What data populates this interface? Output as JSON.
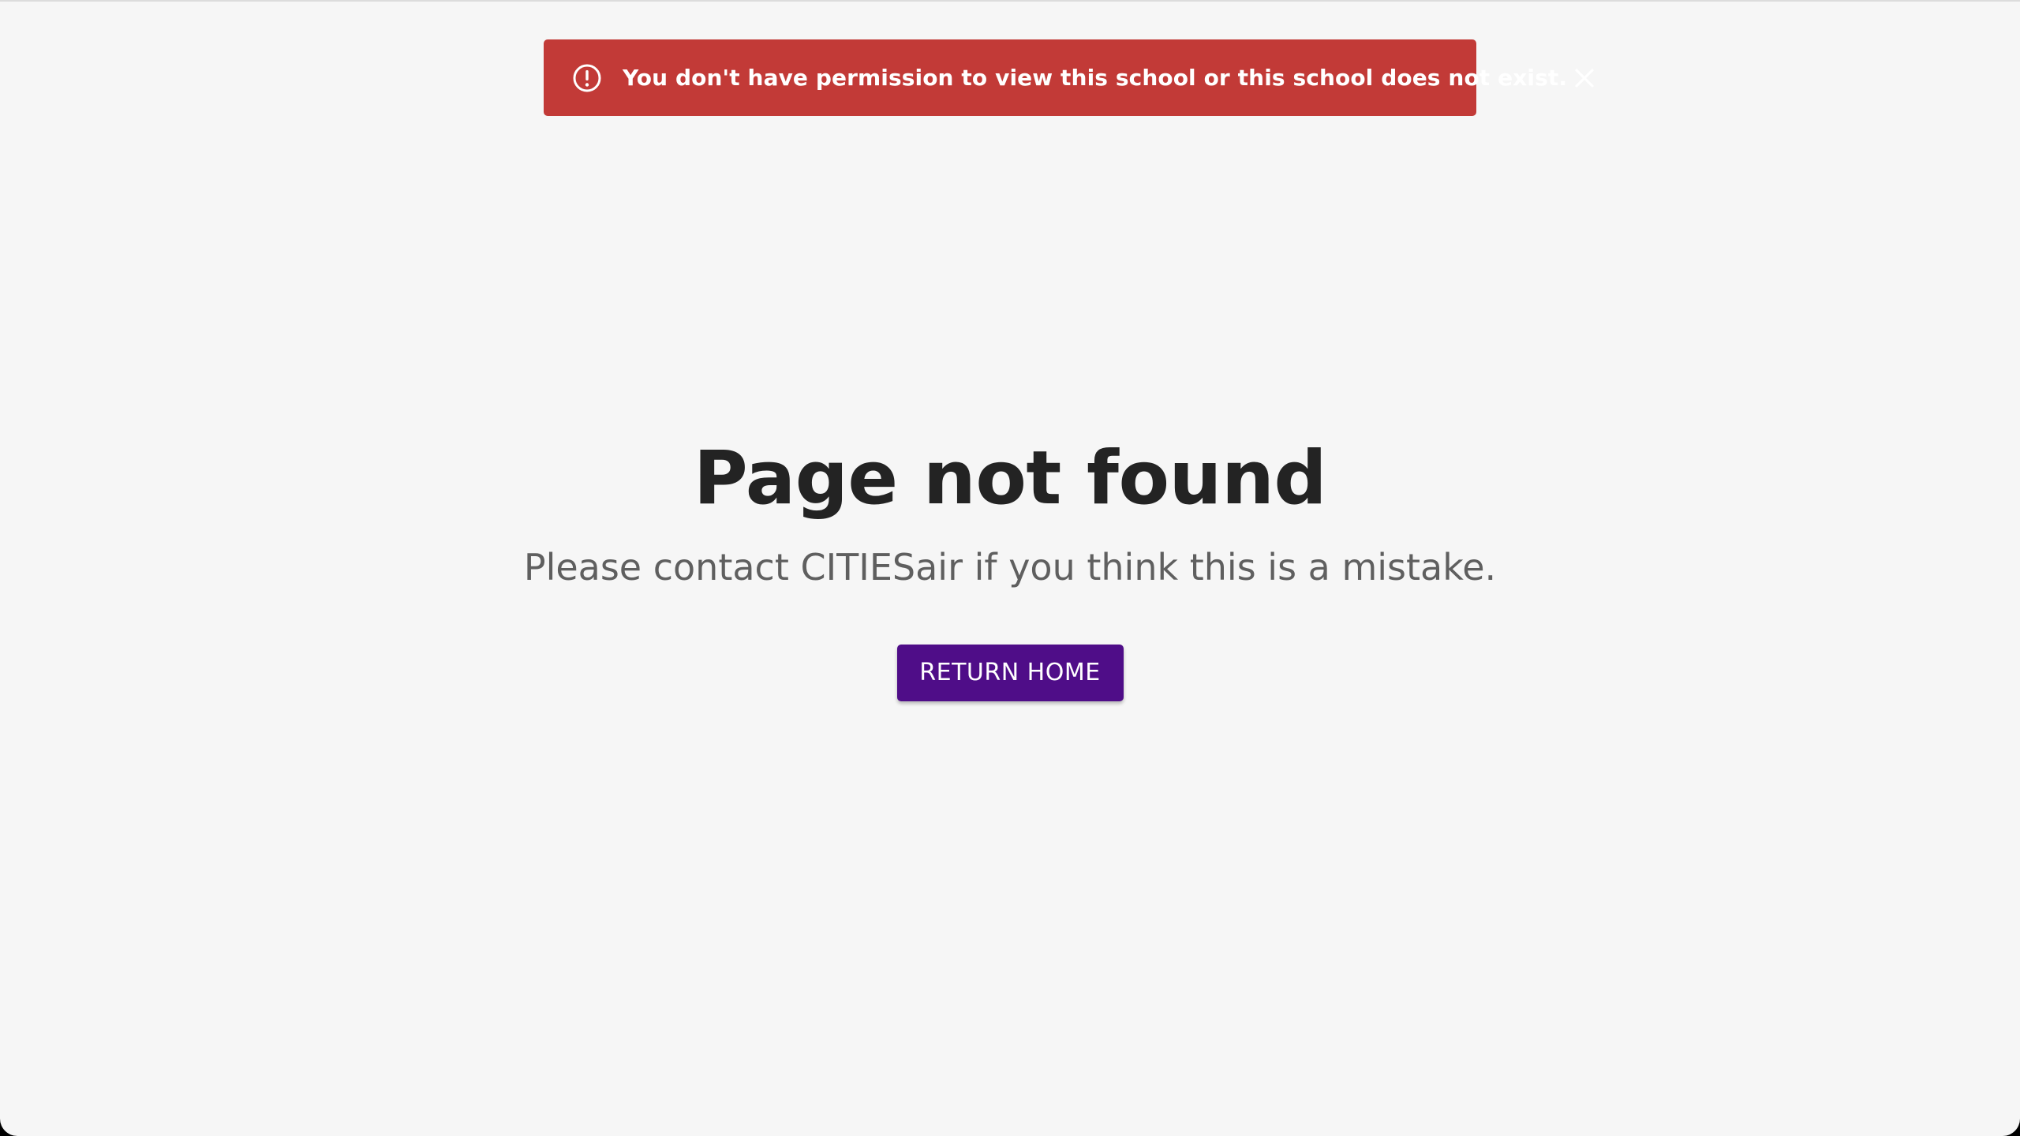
{
  "alert": {
    "icon": "error-circle-icon",
    "message": "You don't have permission to view this school or this school does not exist.",
    "close_icon": "close-icon",
    "background_color": "#c23a37"
  },
  "main": {
    "title": "Page not found",
    "subtitle": "Please contact CITIESair if you think this is a mistake.",
    "return_button_label": "RETURN HOME",
    "button_color": "#4f0d88"
  }
}
